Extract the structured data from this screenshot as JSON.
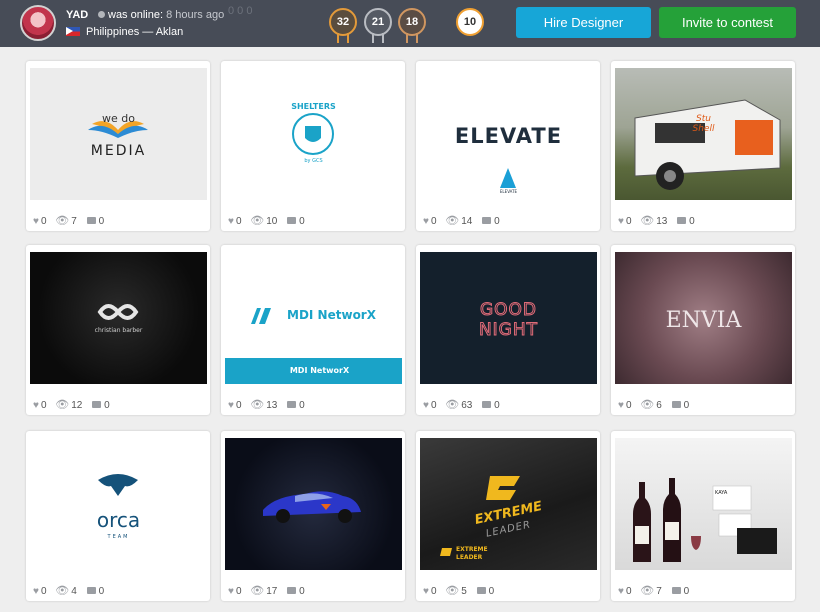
{
  "header": {
    "username": "YAD",
    "status": "was online:",
    "last_seen": "8 hours ago",
    "location": "Philippines — Aklan",
    "ghost": "0   0   0",
    "badges": [
      "32",
      "21",
      "18",
      "10"
    ],
    "hire_label": "Hire Designer",
    "invite_label": "Invite to contest"
  },
  "cards": [
    {
      "likes": "0",
      "views": "7",
      "comments": "0",
      "logo": "we do",
      "logo2": "MEDIA"
    },
    {
      "likes": "0",
      "views": "10",
      "comments": "0",
      "logo": "SHELTERS",
      "logo2": "by GCS"
    },
    {
      "likes": "0",
      "views": "14",
      "comments": "0",
      "logo": "ELEVATE",
      "logo2": "ELEVATE"
    },
    {
      "likes": "0",
      "views": "13",
      "comments": "0",
      "logo": "Stu",
      "logo2": "Shell"
    },
    {
      "likes": "0",
      "views": "12",
      "comments": "0",
      "logo": "christian barber"
    },
    {
      "likes": "0",
      "views": "13",
      "comments": "0",
      "logo": "MDI NetworX",
      "logo2": "MDI NetworX"
    },
    {
      "likes": "0",
      "views": "63",
      "comments": "0",
      "logo": "GOOD",
      "logo2": "NIGHT"
    },
    {
      "likes": "0",
      "views": "6",
      "comments": "0",
      "logo": "ENVIA"
    },
    {
      "likes": "0",
      "views": "4",
      "comments": "0",
      "logo": "orca",
      "logo2": "TEAM"
    },
    {
      "likes": "0",
      "views": "17",
      "comments": "0"
    },
    {
      "likes": "0",
      "views": "5",
      "comments": "0",
      "logo": "EXTREME",
      "logo2": "LEADER",
      "logo3": "EXTREME",
      "logo4": "LEADER"
    },
    {
      "likes": "0",
      "views": "7",
      "comments": "0",
      "logo": "KAYA"
    }
  ],
  "colors": {
    "header": "#474c57",
    "hire": "#17a6d7",
    "invite": "#25a139",
    "badge_gold": "#e39a3a"
  },
  "icons": [
    "heart-icon",
    "eye-icon",
    "comment-icon",
    "star-icon"
  ]
}
